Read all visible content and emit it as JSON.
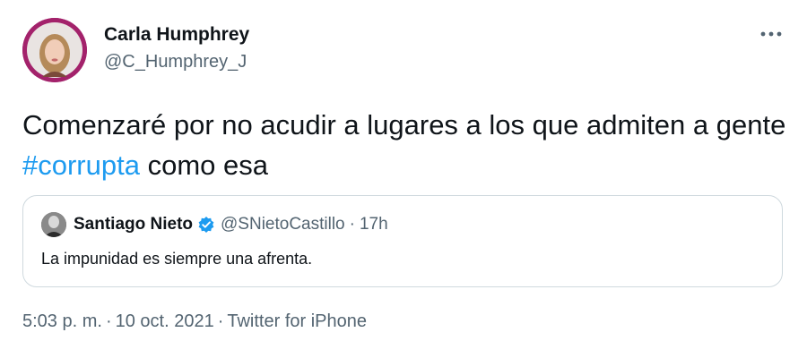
{
  "author": {
    "name": "Carla Humphrey",
    "handle": "@C_Humphrey_J"
  },
  "more_icon": "more-horizontal-icon",
  "tweet": {
    "text_before": "Comenzaré por no acudir a lugares a los que admiten a gente ",
    "hashtag": "#corrupta",
    "text_after": " como esa"
  },
  "quote": {
    "name": "Santiago Nieto",
    "verified_icon": "verified-badge-icon",
    "handle": "@SNietoCastillo",
    "separator": "·",
    "time": "17h",
    "text": "La impunidad es siempre una afrenta."
  },
  "meta": {
    "time": "5:03 p. m.",
    "separator1": "·",
    "date": "10 oct. 2021",
    "separator2": "·",
    "source": "Twitter for iPhone"
  },
  "colors": {
    "accent": "#1d9bf0",
    "secondary_text": "#536471",
    "avatar_ring": "#a3226b",
    "border": "#cfd9de"
  }
}
